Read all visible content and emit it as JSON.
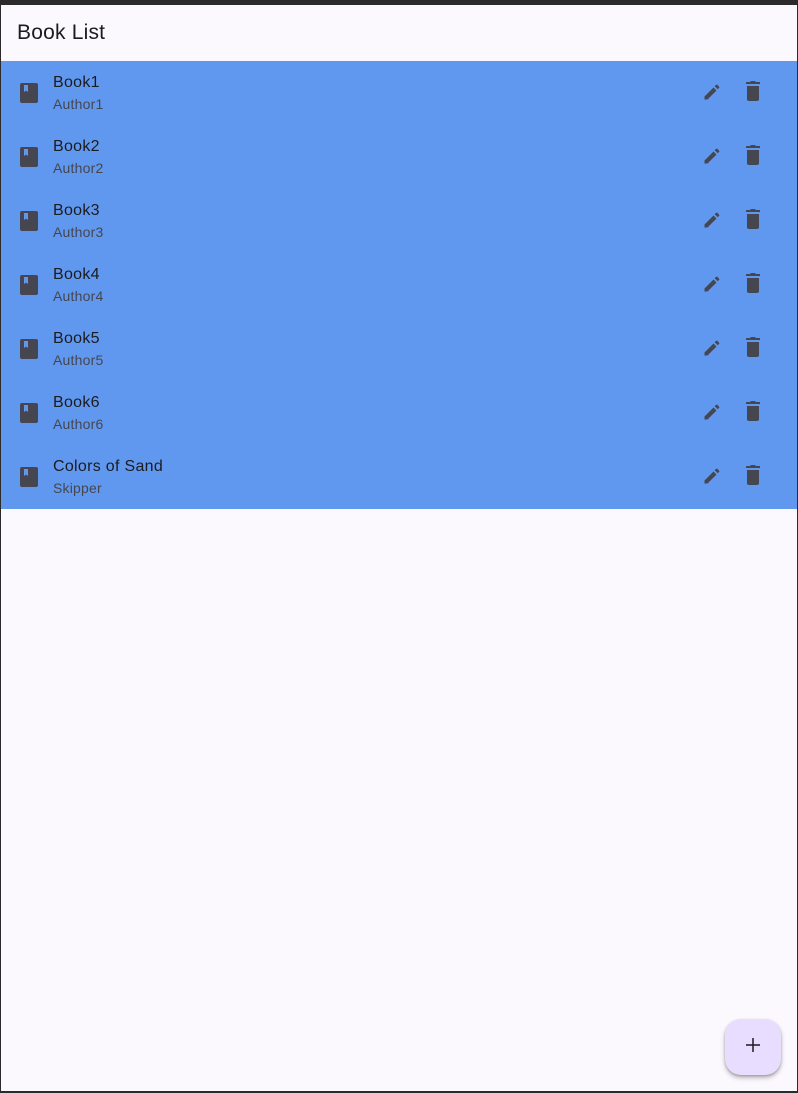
{
  "appbar": {
    "title": "Book List"
  },
  "books": [
    {
      "title": "Book1",
      "author": "Author1"
    },
    {
      "title": "Book2",
      "author": "Author2"
    },
    {
      "title": "Book3",
      "author": "Author3"
    },
    {
      "title": "Book4",
      "author": "Author4"
    },
    {
      "title": "Book5",
      "author": "Author5"
    },
    {
      "title": "Book6",
      "author": "Author6"
    },
    {
      "title": "Colors of Sand",
      "author": "Skipper"
    }
  ],
  "icons": {
    "leading": "book-icon",
    "edit": "pencil-icon",
    "delete": "trash-icon",
    "fab": "plus-icon"
  },
  "colors": {
    "list_background": "#6198ef",
    "page_background": "#fbf8fe",
    "fab_background": "#e9ddff",
    "icon": "#45464f"
  }
}
